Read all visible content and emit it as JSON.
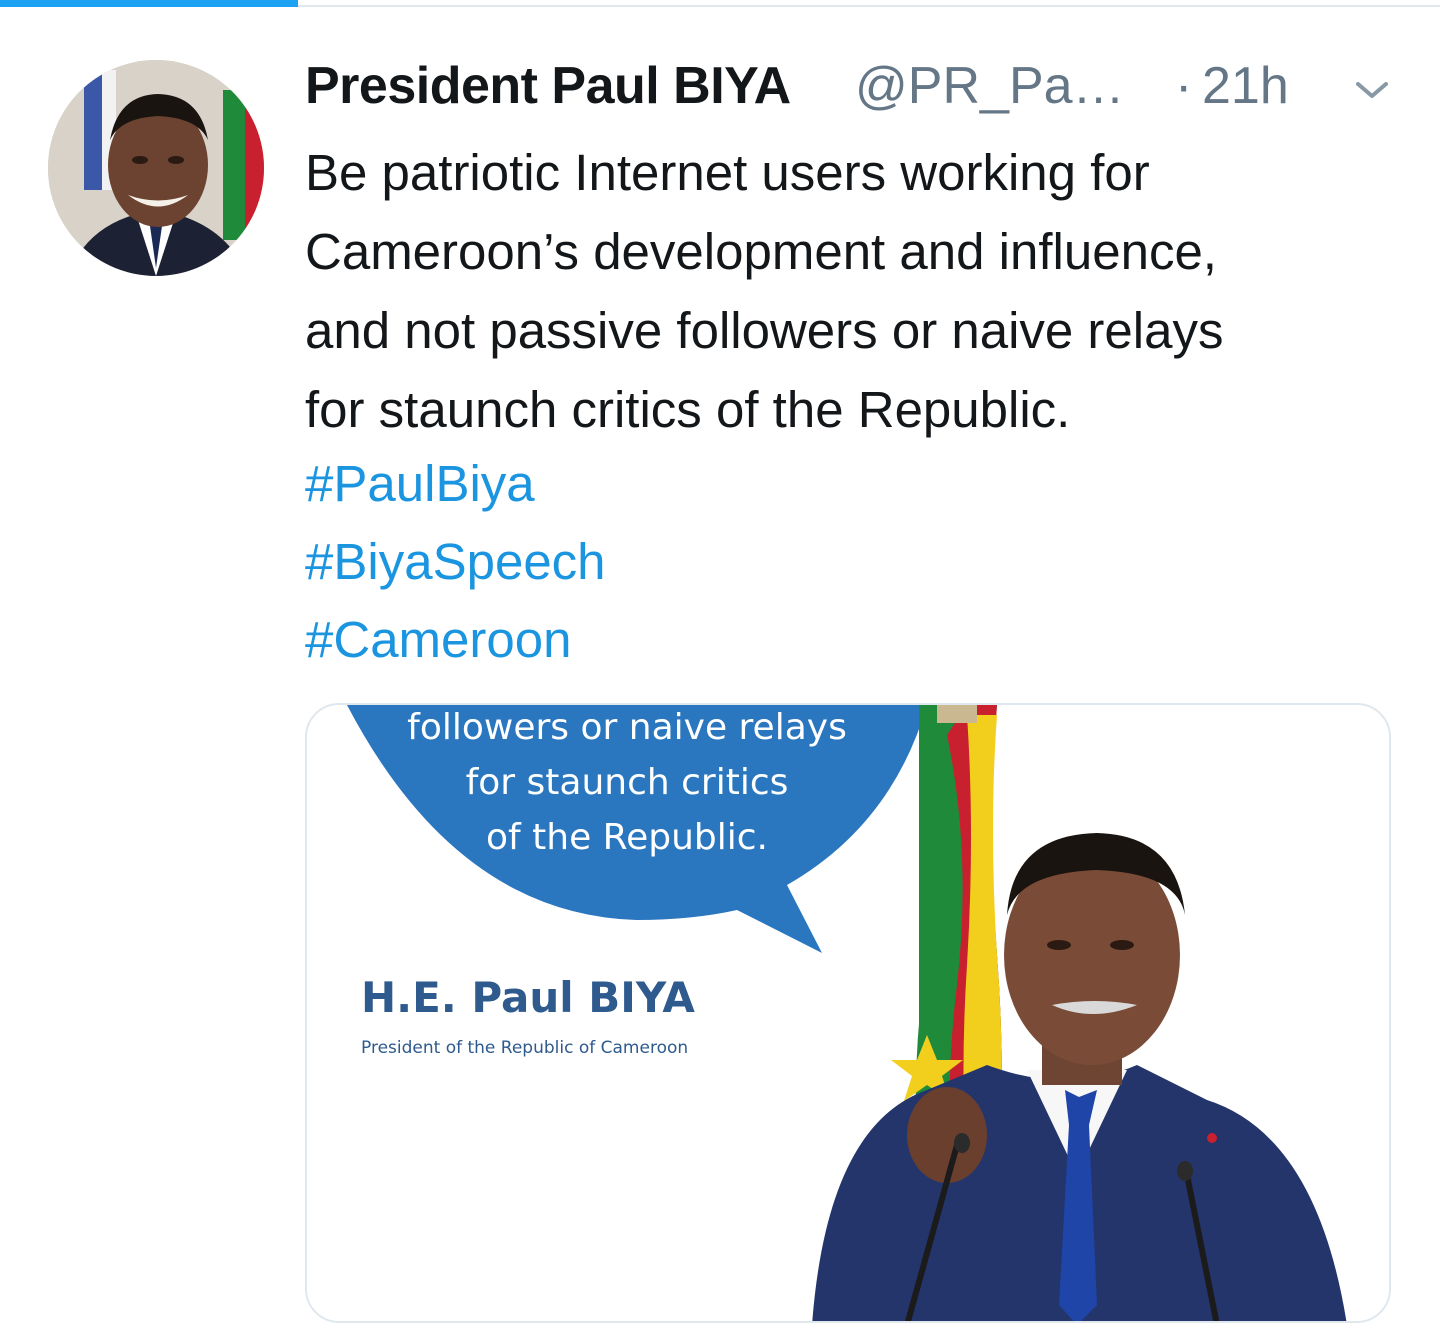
{
  "progress": {
    "fraction": 0.207,
    "color": "#1da1f2"
  },
  "tweet": {
    "display_name": "President Paul BIYA",
    "handle": "@PR_Pa…",
    "separator": "·",
    "timestamp": "21h",
    "menu_icon": "chevron-down-icon",
    "text_lines": [
      "Be patriotic Internet users working for",
      "Cameroon’s development and influence,",
      "and not passive followers or naive relays",
      "for staunch critics of the Republic."
    ],
    "hashtags": [
      "#PaulBiya",
      "#BiyaSpeech",
      "#Cameroon"
    ]
  },
  "media": {
    "bubble_lines": [
      "followers or naive relays",
      "for staunch critics",
      "of the Republic."
    ],
    "caption_name": "H.E. Paul BIYA",
    "caption_title": "President of the Republic of Cameroon"
  },
  "colors": {
    "name_text": "#14171a",
    "secondary_text": "#657786",
    "hashtag": "#1b95e0",
    "bubble_blue": "#2a77c0",
    "caption_blue": "#2e5a8e",
    "flag_green": "#1f8a3a",
    "flag_red": "#c8202f",
    "flag_yellow": "#f3cf1d",
    "suit_blue": "#24356b"
  }
}
